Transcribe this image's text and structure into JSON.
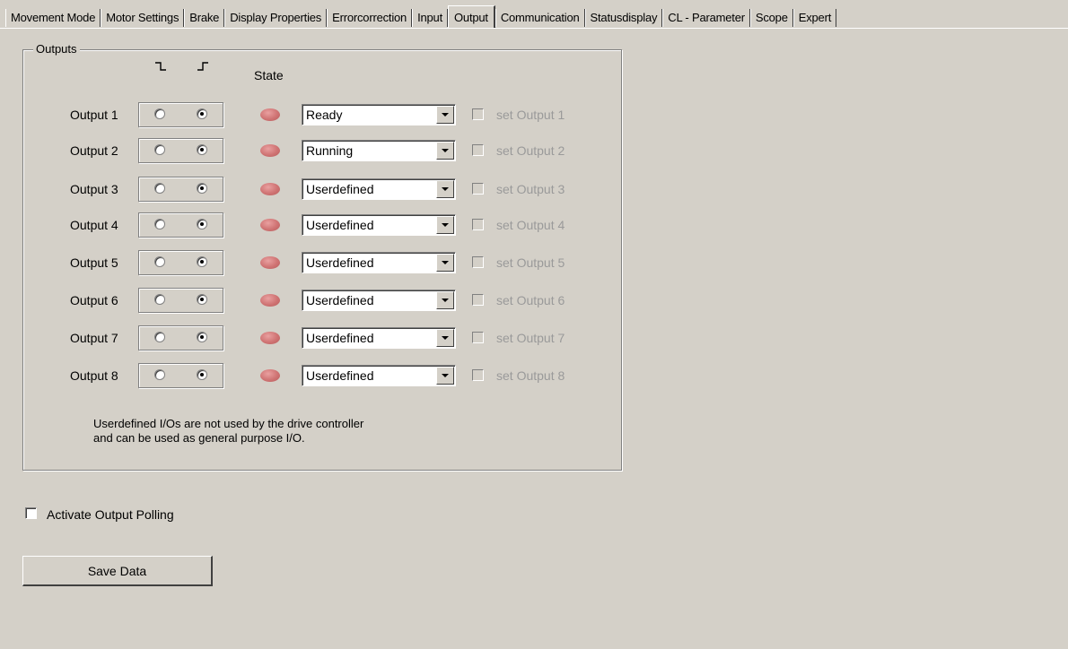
{
  "tabs": [
    {
      "label": "Movement Mode"
    },
    {
      "label": "Motor Settings"
    },
    {
      "label": "Brake"
    },
    {
      "label": "Display Properties"
    },
    {
      "label": "Errorcorrection"
    },
    {
      "label": "Input"
    },
    {
      "label": "Output"
    },
    {
      "label": "Communication"
    },
    {
      "label": "Statusdisplay"
    },
    {
      "label": "CL - Parameter"
    },
    {
      "label": "Scope"
    },
    {
      "label": "Expert"
    }
  ],
  "active_tab": "Output",
  "outputs_group": {
    "title": "Outputs",
    "falling_edge_icon": "falling-edge-icon",
    "rising_edge_icon": "rising-edge-icon",
    "state_header": "State",
    "rows": [
      {
        "label": "Output 1",
        "falling_checked": false,
        "rising_checked": true,
        "led_color": "#cf7373",
        "mode": "Ready",
        "set_label": "set Output 1",
        "set_checked": false,
        "set_enabled": false
      },
      {
        "label": "Output 2",
        "falling_checked": false,
        "rising_checked": true,
        "led_color": "#cf7373",
        "mode": "Running",
        "set_label": "set Output 2",
        "set_checked": false,
        "set_enabled": false
      },
      {
        "label": "Output 3",
        "falling_checked": false,
        "rising_checked": true,
        "led_color": "#cf7373",
        "mode": "Userdefined",
        "set_label": "set Output 3",
        "set_checked": false,
        "set_enabled": false
      },
      {
        "label": "Output 4",
        "falling_checked": false,
        "rising_checked": true,
        "led_color": "#cf7373",
        "mode": "Userdefined",
        "set_label": "set Output 4",
        "set_checked": false,
        "set_enabled": false
      },
      {
        "label": "Output 5",
        "falling_checked": false,
        "rising_checked": true,
        "led_color": "#cf7373",
        "mode": "Userdefined",
        "set_label": "set Output 5",
        "set_checked": false,
        "set_enabled": false
      },
      {
        "label": "Output 6",
        "falling_checked": false,
        "rising_checked": true,
        "led_color": "#cf7373",
        "mode": "Userdefined",
        "set_label": "set Output 6",
        "set_checked": false,
        "set_enabled": false
      },
      {
        "label": "Output 7",
        "falling_checked": false,
        "rising_checked": true,
        "led_color": "#cf7373",
        "mode": "Userdefined",
        "set_label": "set Output 7",
        "set_checked": false,
        "set_enabled": false
      },
      {
        "label": "Output 8",
        "falling_checked": false,
        "rising_checked": true,
        "led_color": "#cf7373",
        "mode": "Userdefined",
        "set_label": "set Output 8",
        "set_checked": false,
        "set_enabled": false
      }
    ],
    "note_line1": "Userdefined I/Os are not used by the drive controller",
    "note_line2": "and can be used as general purpose I/O."
  },
  "polling": {
    "label": "Activate Output Polling",
    "checked": false
  },
  "save_button": {
    "label": "Save Data"
  },
  "colors": {
    "background": "#d4d0c8",
    "disabled_text": "#9a9a9a",
    "led_off": "#cf7373"
  }
}
